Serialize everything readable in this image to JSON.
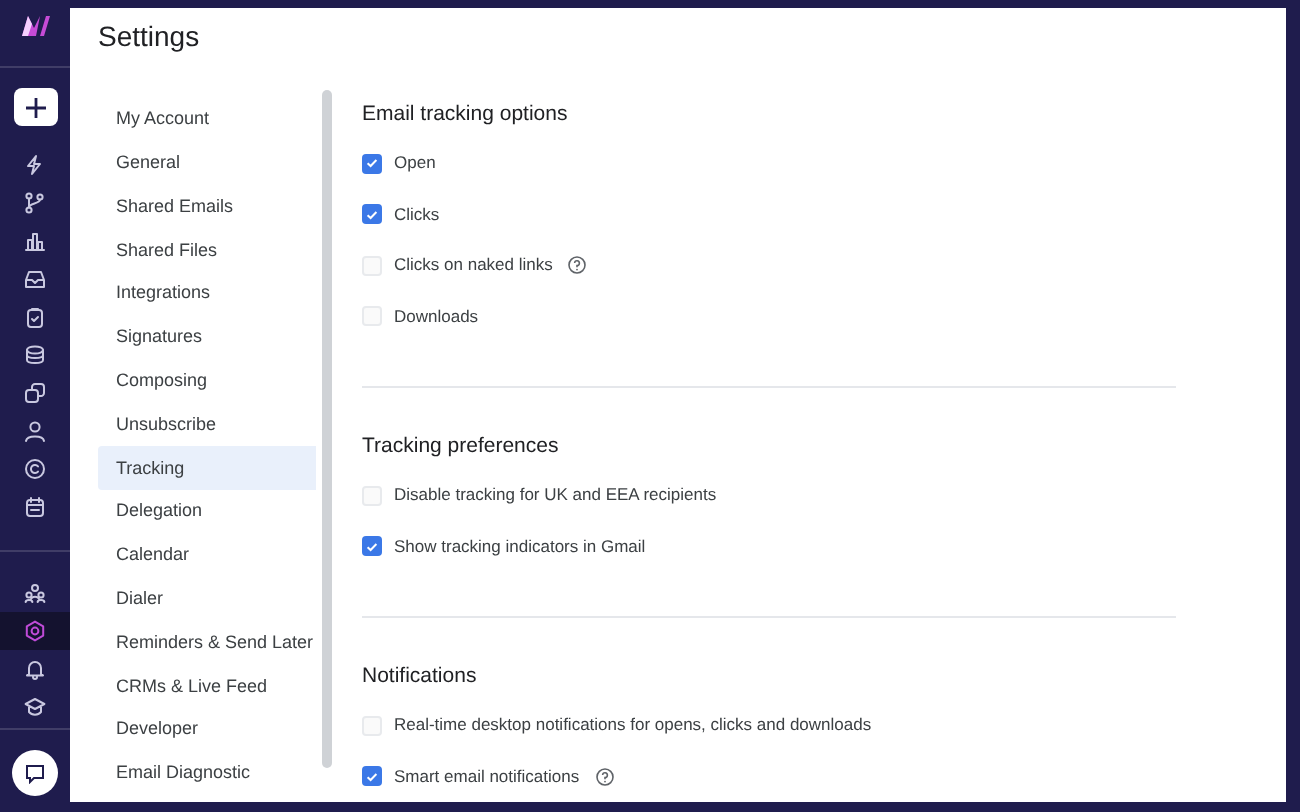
{
  "rail": {
    "items": [
      {
        "kind": "bolt",
        "selected": false
      },
      {
        "kind": "branch",
        "selected": false
      },
      {
        "kind": "chart",
        "selected": false
      },
      {
        "kind": "inbox",
        "selected": false
      },
      {
        "kind": "clipboard",
        "selected": false
      },
      {
        "kind": "stack",
        "selected": false
      },
      {
        "kind": "copy",
        "selected": false
      },
      {
        "kind": "person",
        "selected": false
      },
      {
        "kind": "copyright",
        "selected": false
      },
      {
        "kind": "calendar",
        "selected": false
      }
    ],
    "bottom_items": [
      {
        "kind": "team",
        "selected": false
      },
      {
        "kind": "gear",
        "selected": true
      },
      {
        "kind": "bell",
        "selected": false
      },
      {
        "kind": "cap",
        "selected": false
      }
    ]
  },
  "title": "Settings",
  "menu": [
    {
      "label": "My Account",
      "selected": false
    },
    {
      "label": "General",
      "selected": false
    },
    {
      "label": "Shared Emails",
      "selected": false
    },
    {
      "label": "Shared Files",
      "selected": false
    },
    {
      "label": "Integrations",
      "selected": false
    },
    {
      "label": "Signatures",
      "selected": false
    },
    {
      "label": "Composing",
      "selected": false
    },
    {
      "label": "Unsubscribe",
      "selected": false
    },
    {
      "label": "Tracking",
      "selected": true
    },
    {
      "label": "Delegation",
      "selected": false
    },
    {
      "label": "Calendar",
      "selected": false
    },
    {
      "label": "Dialer",
      "selected": false
    },
    {
      "label": "Reminders & Send Later",
      "selected": false
    },
    {
      "label": "CRMs & Live Feed",
      "selected": false
    },
    {
      "label": "Developer",
      "selected": false
    },
    {
      "label": "Email Diagnostic",
      "selected": false
    }
  ],
  "sections": [
    {
      "heading": "Email tracking options",
      "options": [
        {
          "kind": "plain",
          "label": "Open",
          "checked": true
        },
        {
          "kind": "plain",
          "label": "Clicks",
          "checked": true
        },
        {
          "kind": "help",
          "label": "Clicks on naked links",
          "checked": false
        },
        {
          "kind": "plain",
          "label": "Downloads",
          "checked": false
        }
      ]
    },
    {
      "heading": "Tracking preferences",
      "options": [
        {
          "kind": "plain",
          "label": "Disable tracking for UK and EEA recipients",
          "checked": false
        },
        {
          "kind": "plain",
          "label": "Show tracking indicators in Gmail",
          "checked": true
        }
      ]
    },
    {
      "heading": "Notifications",
      "options": [
        {
          "kind": "plain",
          "label": "Real-time desktop notifications for opens, clicks and downloads",
          "checked": false
        },
        {
          "kind": "help",
          "label": "Smart email notifications",
          "checked": true
        }
      ]
    }
  ]
}
